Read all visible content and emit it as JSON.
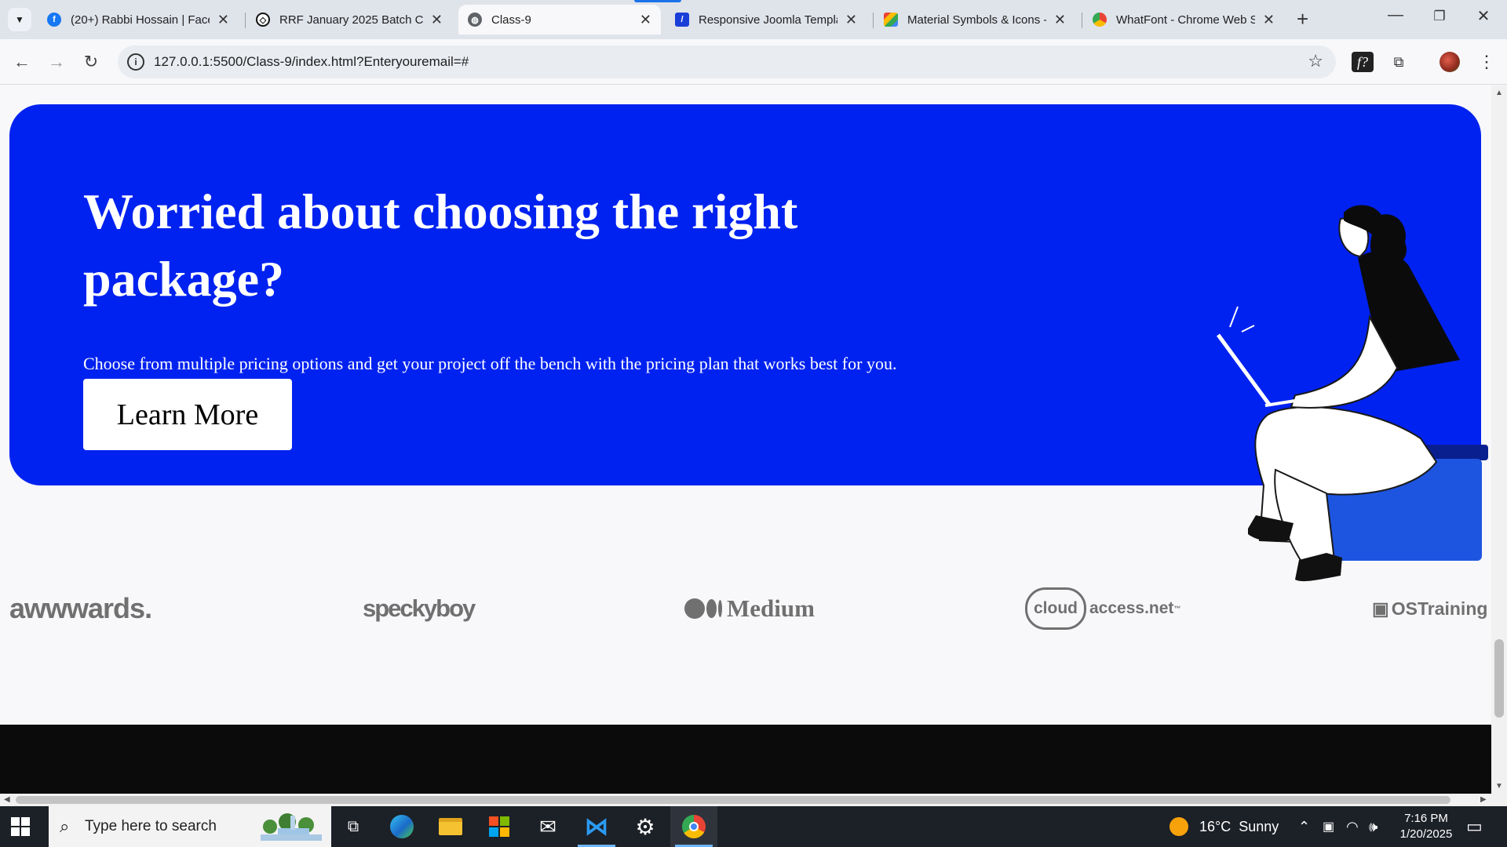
{
  "browser": {
    "tabs": [
      {
        "title": "(20+) Rabbi Hossain | Facebook",
        "icon": "facebook-icon"
      },
      {
        "title": "RRF January 2025 Batch Class",
        "icon": "codepen-icon"
      },
      {
        "title": "Class-9",
        "icon": "globe-icon",
        "active": true
      },
      {
        "title": "Responsive Joomla Templates",
        "icon": "joomla-icon"
      },
      {
        "title": "Material Symbols & Icons - Google Fonts",
        "icon": "google-fonts-icon"
      },
      {
        "title": "WhatFont - Chrome Web Store",
        "icon": "chrome-web-store-icon"
      }
    ],
    "address": "127.0.0.1:5500/Class-9/index.html?Enteryouremail=#"
  },
  "page": {
    "hero": {
      "title": "Worried about choosing the right package?",
      "text": "Choose from multiple pricing options and get your project off the bench with the pricing plan that works best for you.",
      "button": "Learn More",
      "bg_color": "#0022f0"
    },
    "logos": [
      {
        "name": "awwwards."
      },
      {
        "name": "speckyboy"
      },
      {
        "name": "Medium"
      },
      {
        "name": "access.net",
        "badge": "cloud",
        "tm": "™"
      },
      {
        "name": "OSTraining"
      }
    ]
  },
  "taskbar": {
    "search_placeholder": "Type here to search",
    "weather": "16°C  Sunny",
    "time": "7:16 PM",
    "date": "1/20/2025",
    "apps": [
      "task-view-icon",
      "edge-icon",
      "file-explorer-icon",
      "store-icon",
      "mail-icon",
      "vscode-icon",
      "settings-icon",
      "chrome-icon"
    ]
  }
}
